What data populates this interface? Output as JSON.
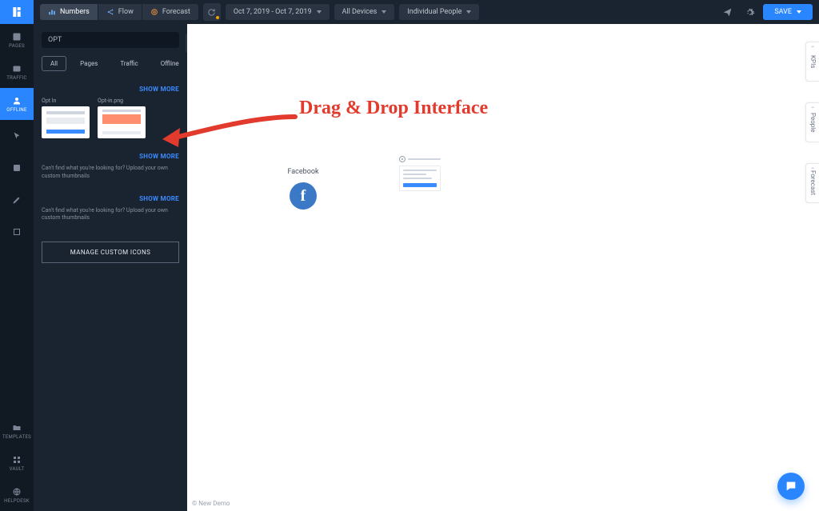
{
  "topbar": {
    "segments": [
      "Numbers",
      "Flow",
      "Forecast"
    ],
    "active_segment": "Numbers",
    "date_label": "Oct 7, 2019 - Oct 7, 2019",
    "device_label": "All Devices",
    "people_label": "Individual People",
    "save_label": "SAVE"
  },
  "leftbar": {
    "items": [
      {
        "name": "pages",
        "label": "PAGES"
      },
      {
        "name": "traffic",
        "label": "TRAFFIC"
      },
      {
        "name": "offline",
        "label": "OFFLINE"
      }
    ],
    "bottom": [
      {
        "name": "templates",
        "label": "TEMPLATES"
      },
      {
        "name": "vault",
        "label": "VAULT"
      },
      {
        "name": "helpdesk",
        "label": "HELPDESK"
      }
    ]
  },
  "panel": {
    "search_value": "OPT",
    "tabs": [
      "All",
      "Pages",
      "Traffic",
      "Offline"
    ],
    "active_tab": "All",
    "show_more": "SHOW MORE",
    "thumbs": [
      {
        "title": "Opt In"
      },
      {
        "title": "Opt-in.png"
      }
    ],
    "help1": "Can't find what you're looking for? Upload your own custom thumbnails",
    "help2": "Can't find what you're looking for? Upload your own custom thumbnails",
    "manage_label": "MANAGE CUSTOM ICONS"
  },
  "canvas": {
    "annotation": "Drag & Drop Interface",
    "fb_label": "Facebook",
    "footer": "© New Demo"
  },
  "right_tabs": [
    "KPIs",
    "People",
    "Forecast"
  ]
}
